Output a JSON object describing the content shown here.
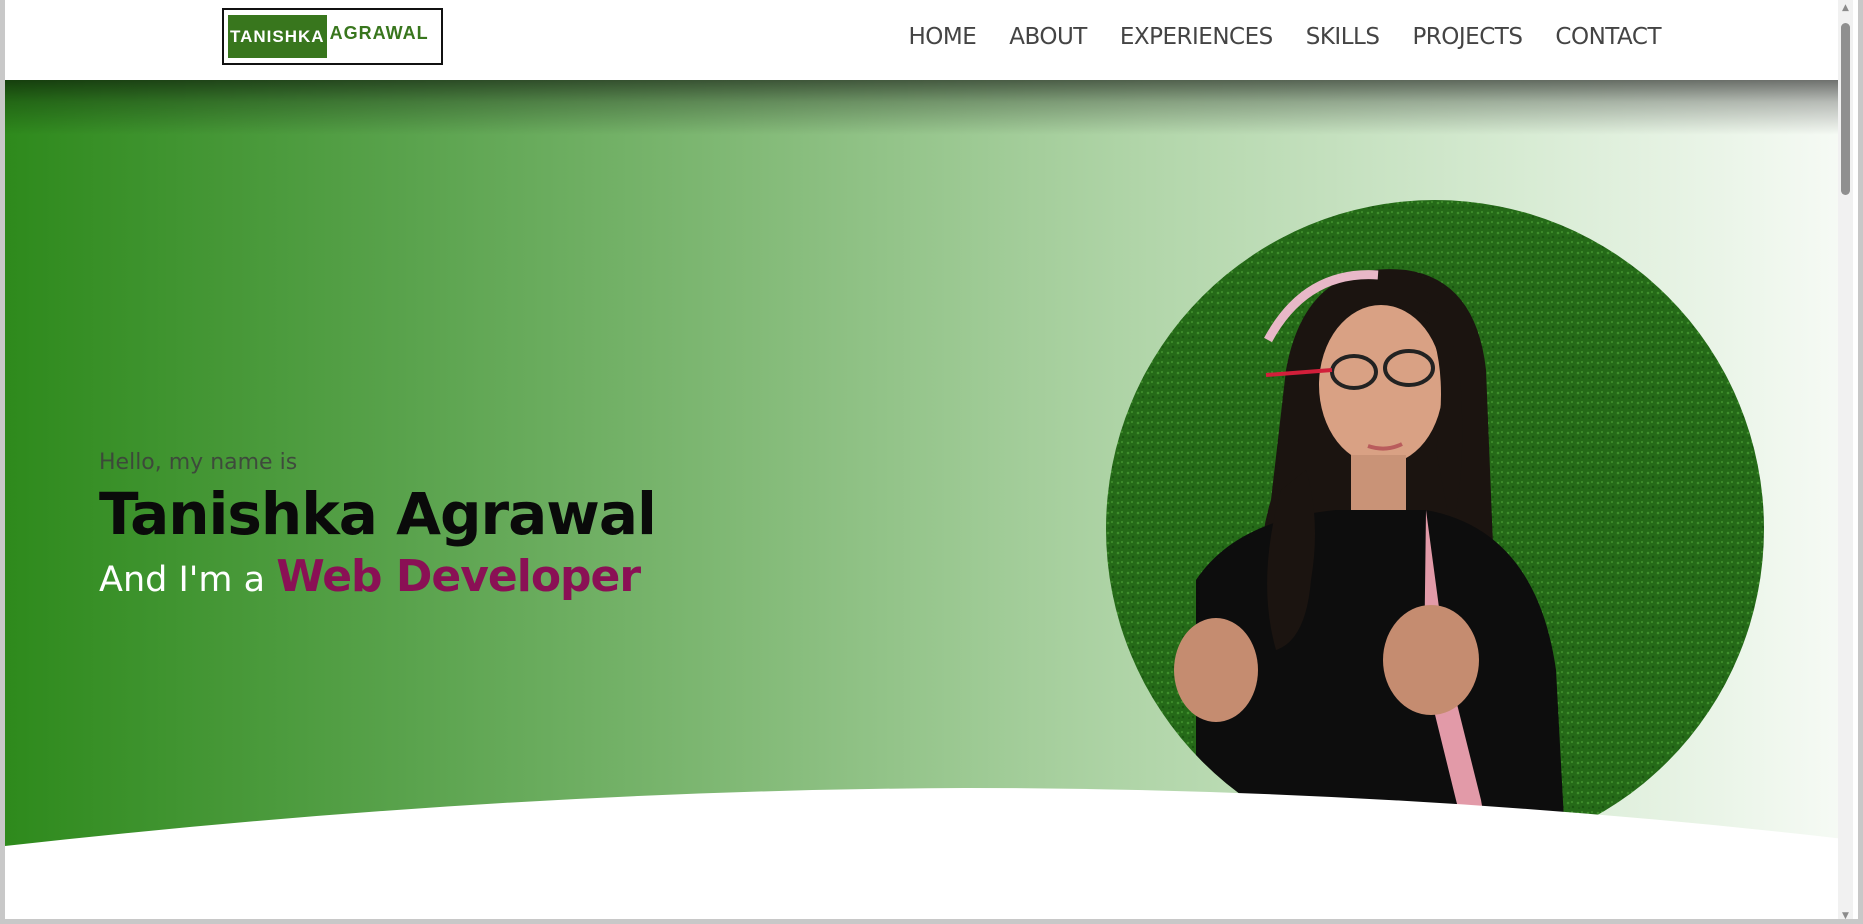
{
  "logo": {
    "first": "TANISHKA",
    "last": "AGRAWAL"
  },
  "nav": {
    "items": [
      "HOME",
      "ABOUT",
      "EXPERIENCES",
      "SKILLS",
      "PROJECTS",
      "CONTACT"
    ]
  },
  "hero": {
    "greeting": "Hello, my name is",
    "name": "Tanishka Agrawal",
    "role_prefix": "And I'm a",
    "role": "Web Developer"
  },
  "colors": {
    "brand_green": "#38761d",
    "accent_magenta": "#8a1055",
    "hero_gradient_start": "#2e8a1c",
    "hero_gradient_end": "#f7fbf6"
  },
  "icons": {
    "scroll_up": "triangle-up-icon",
    "scroll_down": "triangle-down-icon"
  }
}
